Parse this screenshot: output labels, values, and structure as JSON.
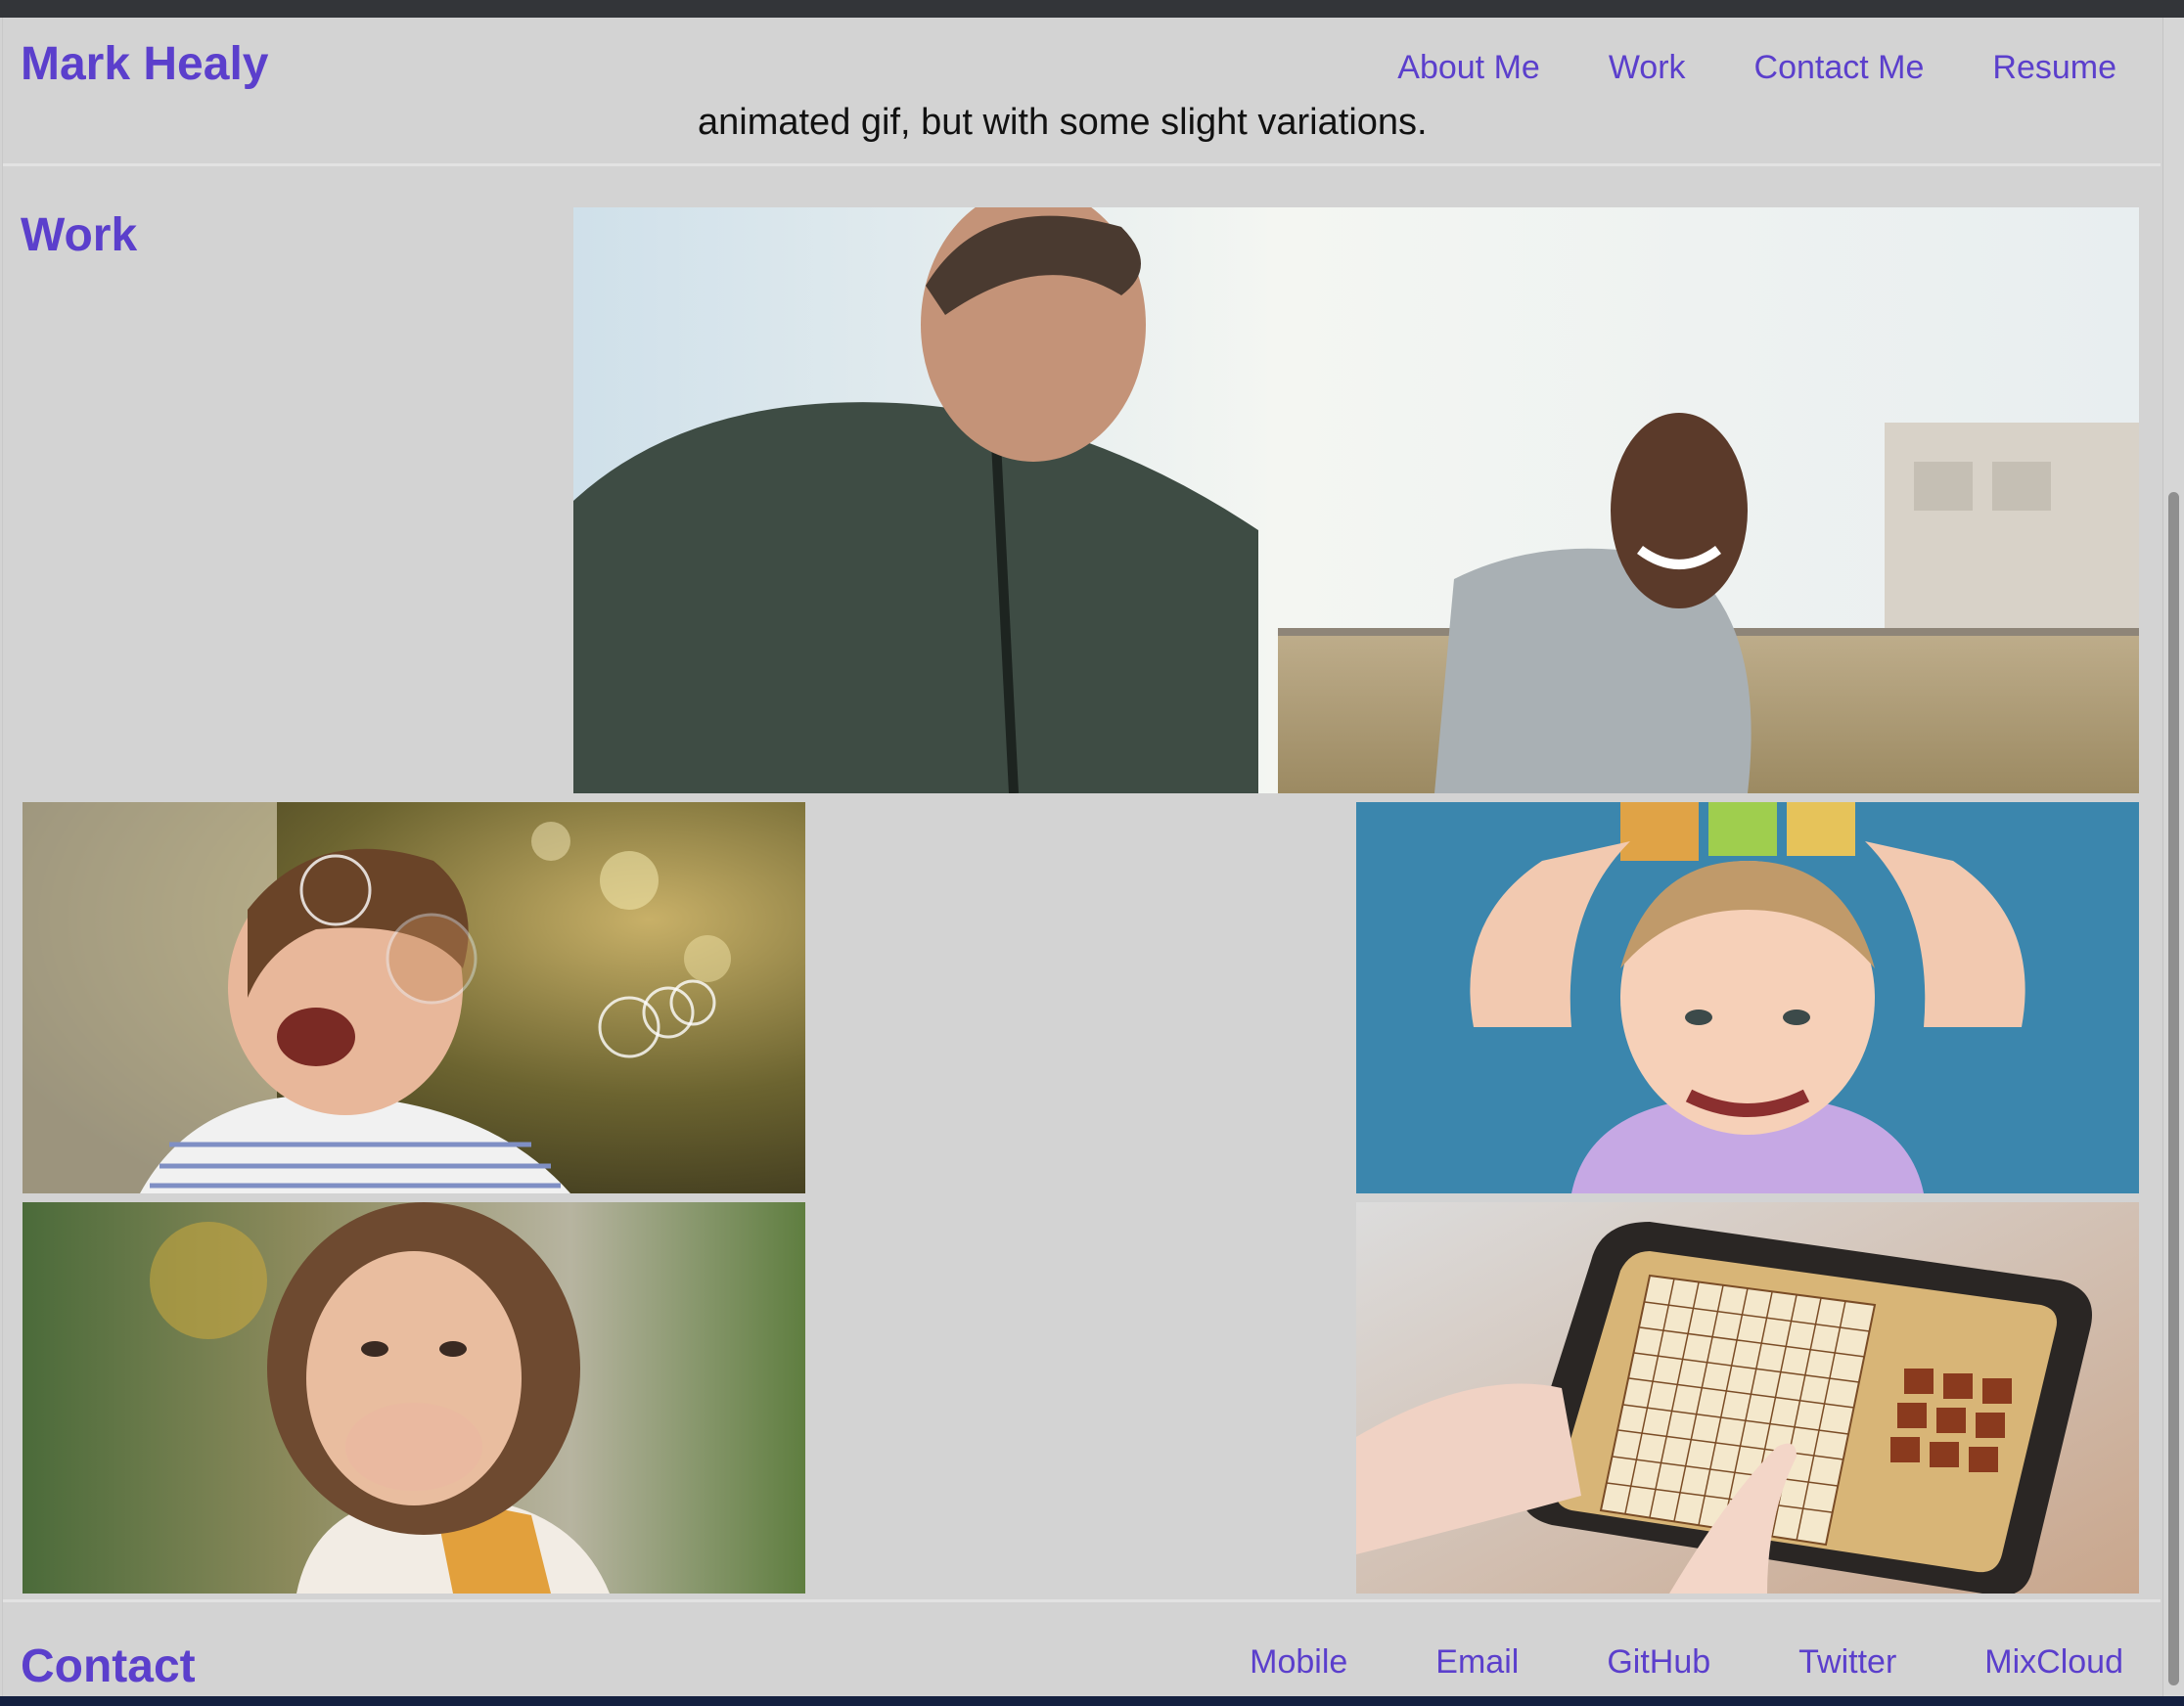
{
  "header": {
    "title": "Mark Healy",
    "nav": [
      "About Me",
      "Work",
      "Contact Me",
      "Resume"
    ],
    "peek_text": "animated gif, but with some slight variations."
  },
  "work": {
    "heading": "Work",
    "images": [
      "two-men-running-photo",
      "boy-with-bubbles-photo",
      "girl-with-abc-blocks-photo",
      "laughing-girl-photo",
      "sudoku-tablet-photo"
    ]
  },
  "footer": {
    "heading": "Contact",
    "links": [
      "Mobile",
      "Email",
      "GitHub",
      "Twitter",
      "MixCloud"
    ]
  },
  "colors": {
    "accent": "#5b3fcc",
    "background": "#d3d3d3",
    "text": "#111111"
  }
}
